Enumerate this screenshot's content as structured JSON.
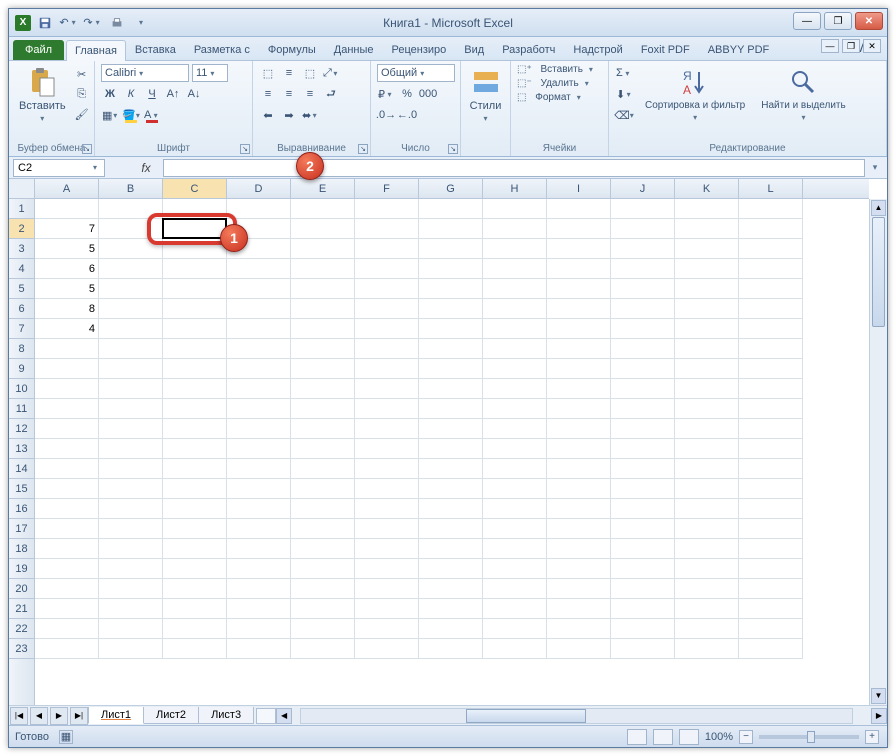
{
  "title": "Книга1 - Microsoft Excel",
  "qat": {
    "save": "save",
    "undo": "undo",
    "redo": "redo",
    "print": "print"
  },
  "ribbon_tabs": {
    "file": "Файл",
    "items": [
      "Главная",
      "Вставка",
      "Разметка с",
      "Формулы",
      "Данные",
      "Рецензиро",
      "Вид",
      "Разработч",
      "Надстрой",
      "Foxit PDF",
      "ABBYY PDF"
    ],
    "active_index": 0
  },
  "groups": {
    "clipboard": {
      "paste": "Вставить",
      "label": "Буфер обмена"
    },
    "font": {
      "name": "Calibri",
      "size": "11",
      "label": "Шрифт",
      "bold": "Ж",
      "italic": "К",
      "underline": "Ч"
    },
    "align": {
      "label": "Выравнивание"
    },
    "number": {
      "format": "Общий",
      "label": "Число"
    },
    "styles": {
      "btn": "Стили"
    },
    "cells": {
      "insert": "Вставить",
      "delete": "Удалить",
      "format": "Формат",
      "label": "Ячейки"
    },
    "editing": {
      "sort": "Сортировка и фильтр",
      "find": "Найти и выделить",
      "label": "Редактирование"
    }
  },
  "formula_bar": {
    "name_box": "C2",
    "fx": "fx"
  },
  "columns": [
    "A",
    "B",
    "C",
    "D",
    "E",
    "F",
    "G",
    "H",
    "I",
    "J",
    "K",
    "L"
  ],
  "rows_count": 23,
  "data": {
    "A2": "7",
    "A3": "5",
    "A4": "6",
    "A5": "5",
    "A6": "8",
    "A7": "4"
  },
  "active_cell": {
    "col": 2,
    "row": 1
  },
  "selected_col": "C",
  "selected_row": 2,
  "sheets": {
    "items": [
      "Лист1",
      "Лист2",
      "Лист3"
    ],
    "active": 0
  },
  "status": {
    "ready": "Готово",
    "zoom": "100%"
  },
  "callouts": {
    "one": "1",
    "two": "2"
  }
}
